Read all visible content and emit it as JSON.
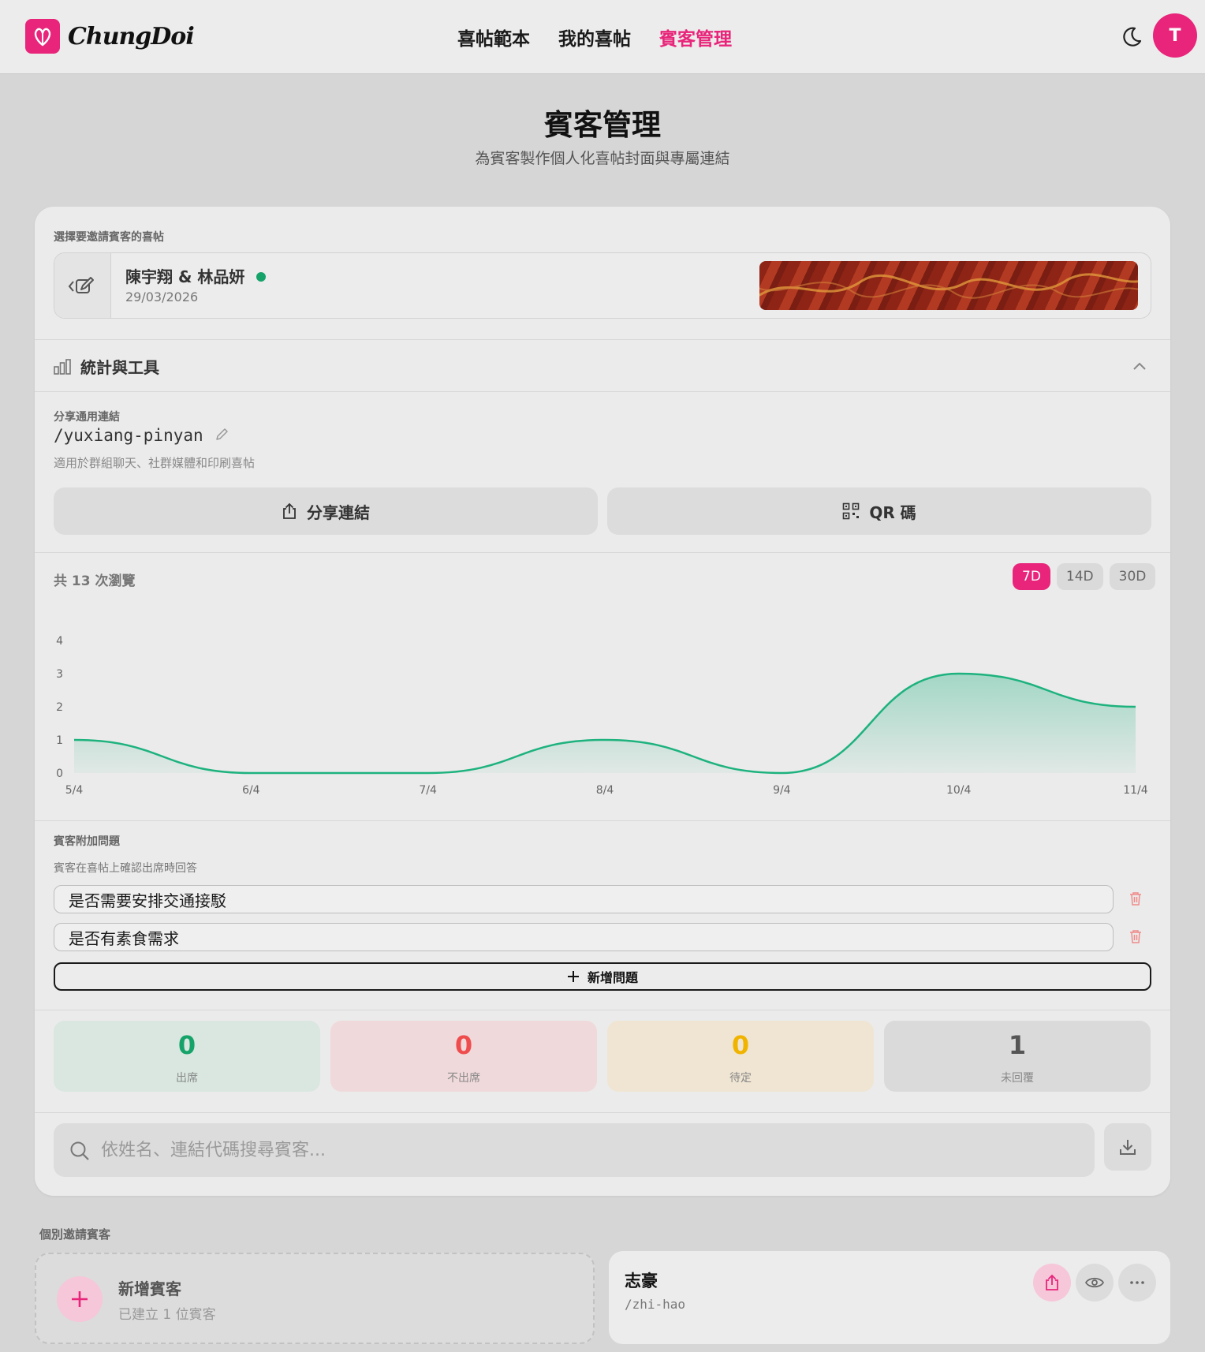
{
  "header": {
    "brand": "ChungDoi",
    "nav": [
      "喜帖範本",
      "我的喜帖",
      "賓客管理"
    ],
    "active_nav": 2,
    "avatar_initial": "T"
  },
  "page": {
    "title": "賓客管理",
    "subtitle": "為賓客製作個人化喜帖封面與專屬連結"
  },
  "invitation": {
    "section_label": "選擇要邀請賓客的喜帖",
    "couple": "陳宇翔 & 林品妍",
    "date": "29/03/2026",
    "status_color": "#16a36a"
  },
  "stats": {
    "title": "統計與工具",
    "share_label": "分享通用連結",
    "slug": "/yuxiang-pinyan",
    "share_hint": "適用於群組聊天、社群媒體和印刷喜帖",
    "share_button": "分享連結",
    "qr_button": "QR 碼",
    "views_total": "共 13 次瀏覽",
    "ranges": [
      "7D",
      "14D",
      "30D"
    ],
    "active_range": "7D"
  },
  "chart_data": {
    "type": "area",
    "x": [
      "5/4",
      "6/4",
      "7/4",
      "8/4",
      "9/4",
      "10/4",
      "11/4"
    ],
    "y_ticks": [
      0,
      1,
      2,
      3,
      4
    ],
    "ylim": [
      0,
      4
    ],
    "series": [
      {
        "values": [
          1,
          0,
          0,
          1,
          0,
          3,
          2
        ]
      }
    ],
    "color": "#1db27e",
    "grid": false
  },
  "questions": {
    "label": "賓客附加問題",
    "hint": "賓客在喜帖上確認出席時回答",
    "items": [
      "是否需要安排交通接駁",
      "是否有素食需求"
    ],
    "add_label": "新增問題"
  },
  "rsvp": [
    {
      "value": "0",
      "label": "出席",
      "color": "#16a36a",
      "bg": "#d9e7e0"
    },
    {
      "value": "0",
      "label": "不出席",
      "color": "#ef4d4d",
      "bg": "#f0d9db"
    },
    {
      "value": "0",
      "label": "待定",
      "color": "#f0b400",
      "bg": "#efe5d2"
    },
    {
      "value": "1",
      "label": "未回覆",
      "color": "#555555",
      "bg": "#dadada"
    }
  ],
  "search": {
    "placeholder": "依姓名、連結代碼搜尋賓客..."
  },
  "guests": {
    "section_label": "個別邀請賓客",
    "add_title": "新增賓客",
    "add_sub": "已建立 1 位賓客",
    "list": [
      {
        "name": "志豪",
        "slug": "/zhi-hao"
      }
    ]
  },
  "colors": {
    "accent": "#e8257a"
  }
}
